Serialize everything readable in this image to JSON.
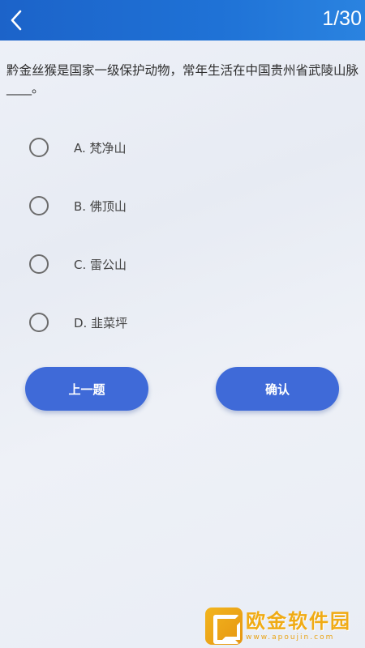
{
  "header": {
    "progress": "1/30"
  },
  "question": {
    "text": "黔金丝猴是国家一级保护动物，常年生活在中国贵州省武陵山脉____。"
  },
  "options": [
    {
      "label": "A. 梵净山"
    },
    {
      "label": "B. 佛顶山"
    },
    {
      "label": "C. 雷公山"
    },
    {
      "label": "D. 韭菜坪"
    }
  ],
  "buttons": {
    "prev_label": "上一题",
    "confirm_label": "确认"
  },
  "watermark": {
    "title": "欧金软件园",
    "url": "www.apoujin.com"
  },
  "colors": {
    "header": "#1f6fd4",
    "button": "#3f6ad8",
    "watermark": "#f0ab14"
  }
}
